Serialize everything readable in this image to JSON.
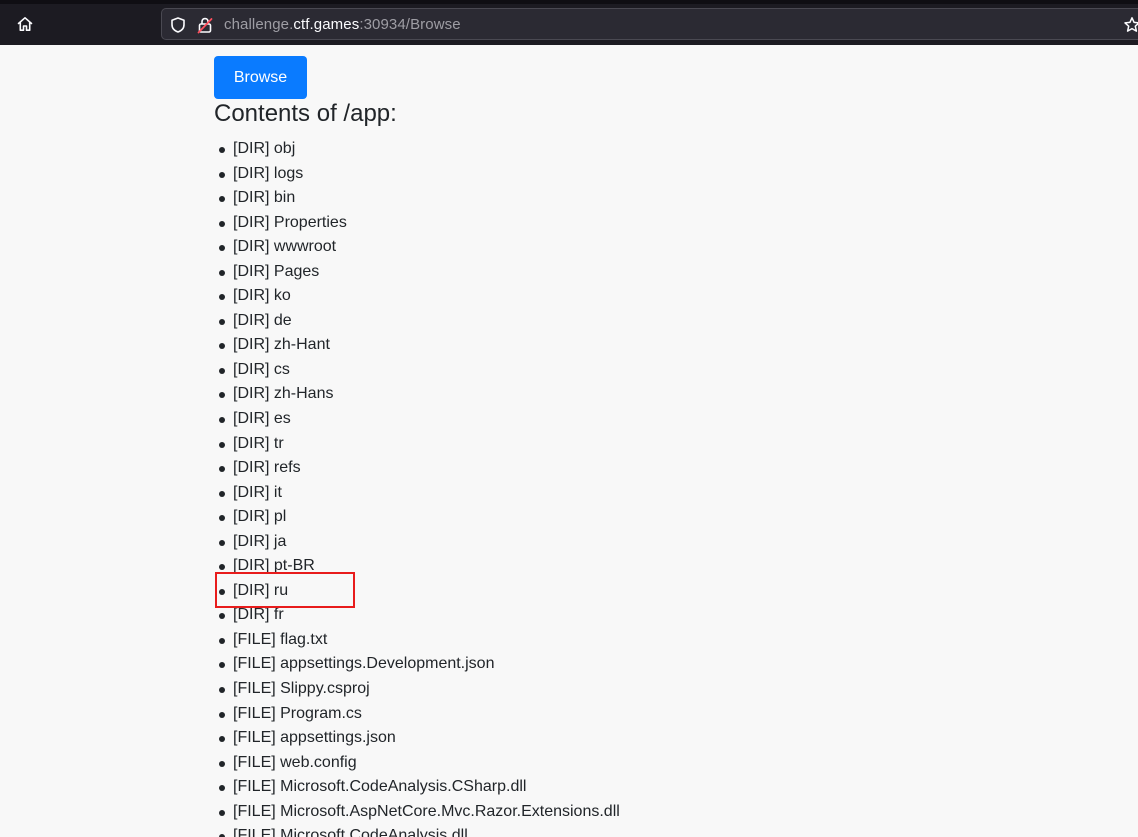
{
  "browser": {
    "url_host_prefix": "challenge.",
    "url_host": "ctf.games",
    "url_rest": ":30934/Browse",
    "icons": {
      "home": "home-icon",
      "shield": "shield-icon",
      "lock": "lock-insecure-icon",
      "bookmark": "star-icon"
    }
  },
  "page": {
    "browse_button": "Browse",
    "title_prefix": "Contents of ",
    "title_path": "/app:",
    "items": [
      "[DIR] obj",
      "[DIR] logs",
      "[DIR] bin",
      "[DIR] Properties",
      "[DIR] wwwroot",
      "[DIR] Pages",
      "[DIR] ko",
      "[DIR] de",
      "[DIR] zh-Hant",
      "[DIR] cs",
      "[DIR] zh-Hans",
      "[DIR] es",
      "[DIR] tr",
      "[DIR] refs",
      "[DIR] it",
      "[DIR] pl",
      "[DIR] ja",
      "[DIR] pt-BR",
      "[DIR] ru",
      "[DIR] fr",
      "[FILE] flag.txt",
      "[FILE] appsettings.Development.json",
      "[FILE] Slippy.csproj",
      "[FILE] Program.cs",
      "[FILE] appsettings.json",
      "[FILE] web.config",
      "[FILE] Microsoft.CodeAnalysis.CSharp.dll",
      "[FILE] Microsoft.AspNetCore.Mvc.Razor.Extensions.dll",
      "[FILE] Microsoft.CodeAnalysis.dll"
    ]
  },
  "colors": {
    "primary_button": "#0a7bff",
    "annotation_box": "#e81c1c"
  }
}
